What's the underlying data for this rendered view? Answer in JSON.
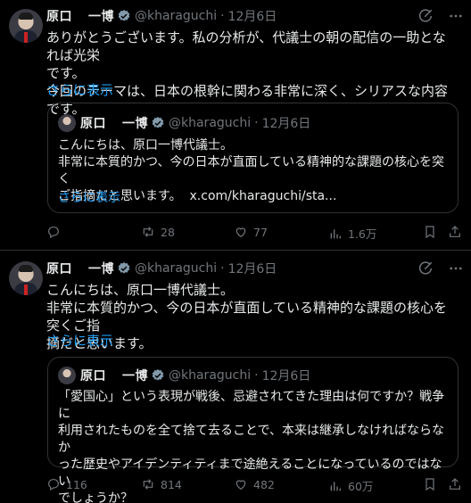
{
  "tweets": [
    {
      "author_name_first": "原口",
      "author_name_last": "一博",
      "handle": "@kharaguchi",
      "separator": "·",
      "date": "12月6日",
      "lines": [
        "ありがとうございます。私の分析が、代議士の朝の配信の一助となれば光栄",
        "です。",
        "今回のテーマは、日本の根幹に関わる非常に深く、シリアスな内容です。"
      ],
      "show_more": "さらに表示",
      "quote": {
        "author_name_first": "原口",
        "author_name_last": "一博",
        "handle": "@kharaguchi",
        "separator": "·",
        "date": "12月6日",
        "lines": [
          "こんにちは、原口一博代議士。",
          "非常に本質的かつ、今の日本が直面している精神的な課題の核心を突く",
          "ご指摘だと思います。"
        ],
        "link": "x.com/kharaguchi/sta...",
        "show_more": "さらに表示"
      },
      "actions": {
        "replies": "",
        "reposts": "28",
        "likes": "77",
        "views": "1.6万"
      }
    },
    {
      "author_name_first": "原口",
      "author_name_last": "一博",
      "handle": "@kharaguchi",
      "separator": "·",
      "date": "12月6日",
      "lines": [
        "こんにちは、原口一博代議士。",
        "非常に本質的かつ、今の日本が直面している精神的な課題の核心を突くご指",
        "摘だと思います。"
      ],
      "show_more": "さらに表示",
      "quote": {
        "author_name_first": "原口",
        "author_name_last": "一博",
        "handle": "@kharaguchi",
        "separator": "·",
        "date": "12月6日",
        "lines": [
          "「愛国心」という表現が戦後、忌避されてきた理由は何ですか？戦争に",
          "利用されたものを全て捨て去ることで、本来は継承しなければならなか",
          "った歴史やアイデンティティまで途絶えることになっているのではない",
          "でしょうか？"
        ]
      },
      "actions": {
        "replies": "116",
        "reposts": "814",
        "likes": "482",
        "views": "60万"
      }
    }
  ],
  "colors": {
    "background": "#000000",
    "text": "#e7e9ea",
    "muted": "#71767b",
    "link": "#1d9bf0",
    "border": "#2f3336",
    "verified": "#829aab"
  },
  "icons": [
    "grok-icon",
    "more-icon",
    "reply-icon",
    "repost-icon",
    "like-icon",
    "views-icon",
    "bookmark-icon",
    "share-icon",
    "verified-badge-icon"
  ]
}
